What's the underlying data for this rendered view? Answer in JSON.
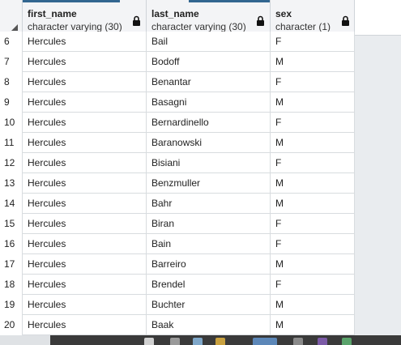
{
  "table": {
    "columns": [
      {
        "name": "first_name",
        "type": "character varying (30)"
      },
      {
        "name": "last_name",
        "type": "character varying (30)"
      },
      {
        "name": "sex",
        "type": "character (1)"
      }
    ],
    "rows": [
      {
        "num": "6",
        "first_name": "Hercules",
        "last_name": "Bail",
        "sex": "F"
      },
      {
        "num": "7",
        "first_name": "Hercules",
        "last_name": "Bodoff",
        "sex": "M"
      },
      {
        "num": "8",
        "first_name": "Hercules",
        "last_name": "Benantar",
        "sex": "F"
      },
      {
        "num": "9",
        "first_name": "Hercules",
        "last_name": "Basagni",
        "sex": "M"
      },
      {
        "num": "10",
        "first_name": "Hercules",
        "last_name": "Bernardinello",
        "sex": "F"
      },
      {
        "num": "11",
        "first_name": "Hercules",
        "last_name": "Baranowski",
        "sex": "M"
      },
      {
        "num": "12",
        "first_name": "Hercules",
        "last_name": "Bisiani",
        "sex": "F"
      },
      {
        "num": "13",
        "first_name": "Hercules",
        "last_name": "Benzmuller",
        "sex": "M"
      },
      {
        "num": "14",
        "first_name": "Hercules",
        "last_name": "Bahr",
        "sex": "M"
      },
      {
        "num": "15",
        "first_name": "Hercules",
        "last_name": "Biran",
        "sex": "F"
      },
      {
        "num": "16",
        "first_name": "Hercules",
        "last_name": "Bain",
        "sex": "F"
      },
      {
        "num": "17",
        "first_name": "Hercules",
        "last_name": "Barreiro",
        "sex": "M"
      },
      {
        "num": "18",
        "first_name": "Hercules",
        "last_name": "Brendel",
        "sex": "F"
      },
      {
        "num": "19",
        "first_name": "Hercules",
        "last_name": "Buchter",
        "sex": "M"
      },
      {
        "num": "20",
        "first_name": "Hercules",
        "last_name": "Baak",
        "sex": "M"
      }
    ]
  },
  "colors": {
    "header_accent": "#326690",
    "grid_line": "#d8dcdf",
    "empty_area": "#e9ecef"
  },
  "icons": {
    "column_lock": "lock-icon",
    "sort_corner": "corner-triangle-icon"
  }
}
